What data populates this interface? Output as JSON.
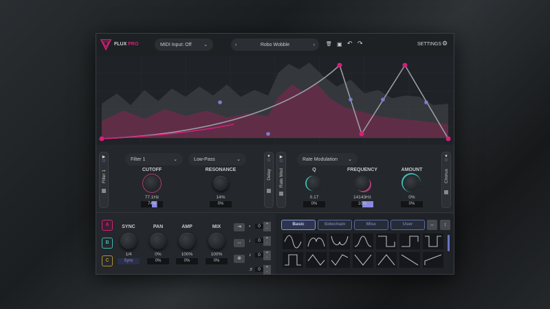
{
  "header": {
    "logo": "FLUX",
    "logo_accent": "PRO",
    "midi": "MIDI Input: Off",
    "preset": "Robo Wobble",
    "settings": "SETTINGS"
  },
  "fx1": {
    "side_left": "Filter 1",
    "filter_select": "Filter 1",
    "type_select": "Low-Pass",
    "cutoff": {
      "label": "CUTOFF",
      "value": "77.1Hz",
      "mod": "74%"
    },
    "resonance": {
      "label": "RESONANCE",
      "value": "14%",
      "mod": "0%"
    },
    "side_right": "Delay"
  },
  "fx2": {
    "side_left": "Rate Mod",
    "select": "Rate Modulation",
    "q": {
      "label": "Q",
      "value": "0.17",
      "mod": "0%"
    },
    "frequency": {
      "label": "FREQUENCY",
      "value": "14143Hz",
      "mod": "10%"
    },
    "amount": {
      "label": "AMOUNT",
      "value": "0%",
      "mod": "0%"
    },
    "side_right": "Chorus"
  },
  "lfo": {
    "slots": [
      "A",
      "B",
      "C"
    ],
    "sync": {
      "label": "SYNC",
      "value": "1/4",
      "mod": "Sync"
    },
    "pan": {
      "label": "PAN",
      "value": "0%",
      "mod": "0%"
    },
    "amp": {
      "label": "AMP",
      "value": "100%",
      "mod": "0%"
    },
    "mix": {
      "label": "MIX",
      "value": "100%",
      "mod": "0%"
    },
    "steppers": [
      "0",
      "0",
      "0",
      "0"
    ],
    "plus": "+",
    "minus": "-"
  },
  "shapes": {
    "tabs": [
      "Basic",
      "Sidechain",
      "Misc",
      "User"
    ]
  },
  "colors": {
    "accent": "#d4207a",
    "teal": "#3fb8b0",
    "blue": "#6a74c8"
  }
}
